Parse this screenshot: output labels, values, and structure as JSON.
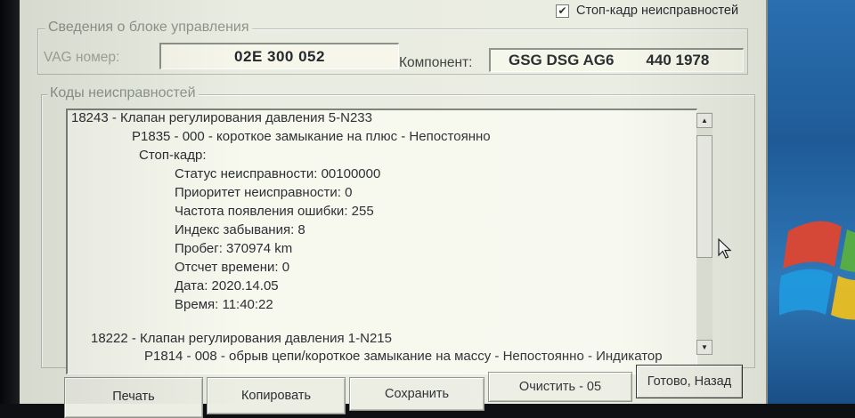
{
  "freeze_frame": {
    "label": "Стоп-кадр неисправностей",
    "checked": true
  },
  "ecu_info": {
    "legend": "Сведения о блоке управления",
    "vag_label": "VAG номер:",
    "vag_value": "02E 300 052",
    "component_label": "Компонент:",
    "component_name": "GSG DSG AG6",
    "component_code": "440 1978"
  },
  "fault_codes": {
    "legend": "Коды неисправностей",
    "lines": [
      "18243 - Клапан регулирования давления 5-N233",
      "P1835 - 000 - короткое замыкание на плюс - Непостоянно",
      "Стоп-кадр:",
      "Статус неисправности: 00100000",
      "Приоритет неисправности: 0",
      "Частота появления ошибки: 255",
      "Индекс забывания: 8",
      "Пробег: 370974 km",
      "Отсчет времени: 0",
      "Дата: 2020.14.05",
      "Время: 11:40:22",
      "18222 - Клапан регулирования давления 1-N215",
      "P1814 - 008 - обрыв цепи/короткое замыкание на массу - Непостоянно - Индикатор"
    ]
  },
  "buttons": {
    "print": "Печать",
    "copy": "Копировать",
    "save": "Сохранить",
    "clear": "Очистить - 05",
    "done": "Готово, Назад"
  },
  "icons": {
    "checkbox": "check-icon",
    "scroll_up": "arrow-up-icon",
    "scroll_down": "arrow-down-icon",
    "cursor": "mouse-pointer-icon"
  },
  "colors": {
    "window_bg": "#e9ece0",
    "field_bg": "#f6f7ea",
    "legend_text": "#8e958c",
    "desktop_blue": "#2a6fb0"
  }
}
